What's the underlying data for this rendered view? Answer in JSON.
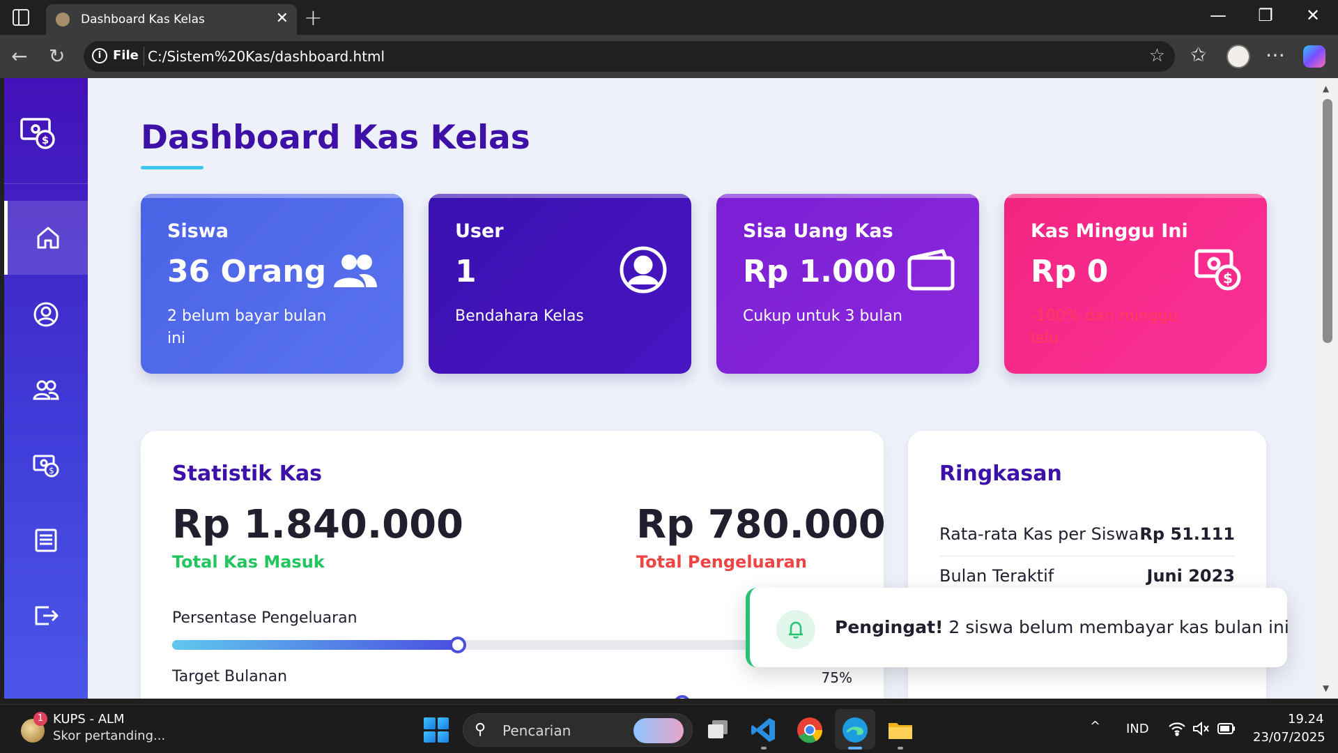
{
  "browser": {
    "tab_title": "Dashboard Kas Kelas",
    "url_scheme": "File",
    "url": "C:/Sistem%20Kas/dashboard.html",
    "new_tab_glyph": "+",
    "close_glyph": "✕",
    "back_glyph": "←",
    "reload_glyph": "↻",
    "star_glyph": "☆",
    "favorites_glyph": "✩",
    "more_glyph": "⋯",
    "minimize_glyph": "—",
    "restore_glyph": "❐",
    "window_close_glyph": "✕"
  },
  "sidebar": {
    "items": [
      {
        "name": "home",
        "icon": "home-icon",
        "active": true
      },
      {
        "name": "profile",
        "icon": "user-circle-icon",
        "active": false
      },
      {
        "name": "students",
        "icon": "users-icon",
        "active": false
      },
      {
        "name": "cash",
        "icon": "money-icon",
        "active": false
      },
      {
        "name": "reports",
        "icon": "report-icon",
        "active": false
      },
      {
        "name": "logout",
        "icon": "logout-icon",
        "active": false
      }
    ]
  },
  "page": {
    "title": "Dashboard Kas Kelas"
  },
  "cards": [
    {
      "label": "Siswa",
      "value": "36 Orang",
      "sub": "2 belum bayar bulan ini",
      "icon": "users-icon",
      "color": "#4f6ce8"
    },
    {
      "label": "User",
      "value": "1",
      "sub": "Bendahara Kelas",
      "icon": "user-circle-icon",
      "color": "#3f13b8"
    },
    {
      "label": "Sisa Uang Kas",
      "value": "Rp 1.000",
      "sub": "Cukup untuk 3 bulan",
      "icon": "wallet-icon",
      "color": "#8a23d8"
    },
    {
      "label": "Kas Minggu Ini",
      "value": "Rp 0",
      "sub": "-100% dari minggu lalu",
      "icon": "money-icon",
      "color": "#f5288e",
      "sub_color": "#ff3b5c"
    }
  ],
  "statistik": {
    "title": "Statistik Kas",
    "income_amount": "Rp 1.840.000",
    "income_label": "Total Kas Masuk",
    "income_color": "#22c55e",
    "expense_amount": "Rp 780.000",
    "expense_label": "Total Pengeluaran",
    "expense_color": "#ef4444",
    "bars": [
      {
        "label": "Persentase Pengeluaran",
        "percent_text": "",
        "fraction": 0.42
      },
      {
        "label": "Target Bulanan",
        "percent_text": "75%",
        "fraction": 0.75
      }
    ]
  },
  "ringkasan": {
    "title": "Ringkasan",
    "rows": [
      {
        "label": "Rata-rata Kas per Siswa",
        "value": "Rp 51.111"
      },
      {
        "label": "Bulan Teraktif",
        "value": "Juni 2023"
      }
    ]
  },
  "toast": {
    "strong": "Pengingat!",
    "message": "2 siswa belum membayar kas bulan ini",
    "icon": "bell-icon"
  },
  "taskbar": {
    "widget_badge": "1",
    "widget_title": "KUPS - ALM",
    "widget_sub": "Skor pertanding...",
    "search_placeholder": "Pencarian",
    "tray_chevron": "^",
    "language": "IND",
    "time": "19.24",
    "date": "23/07/2025"
  },
  "scrollbar": {
    "up": "▲",
    "down": "▼"
  }
}
